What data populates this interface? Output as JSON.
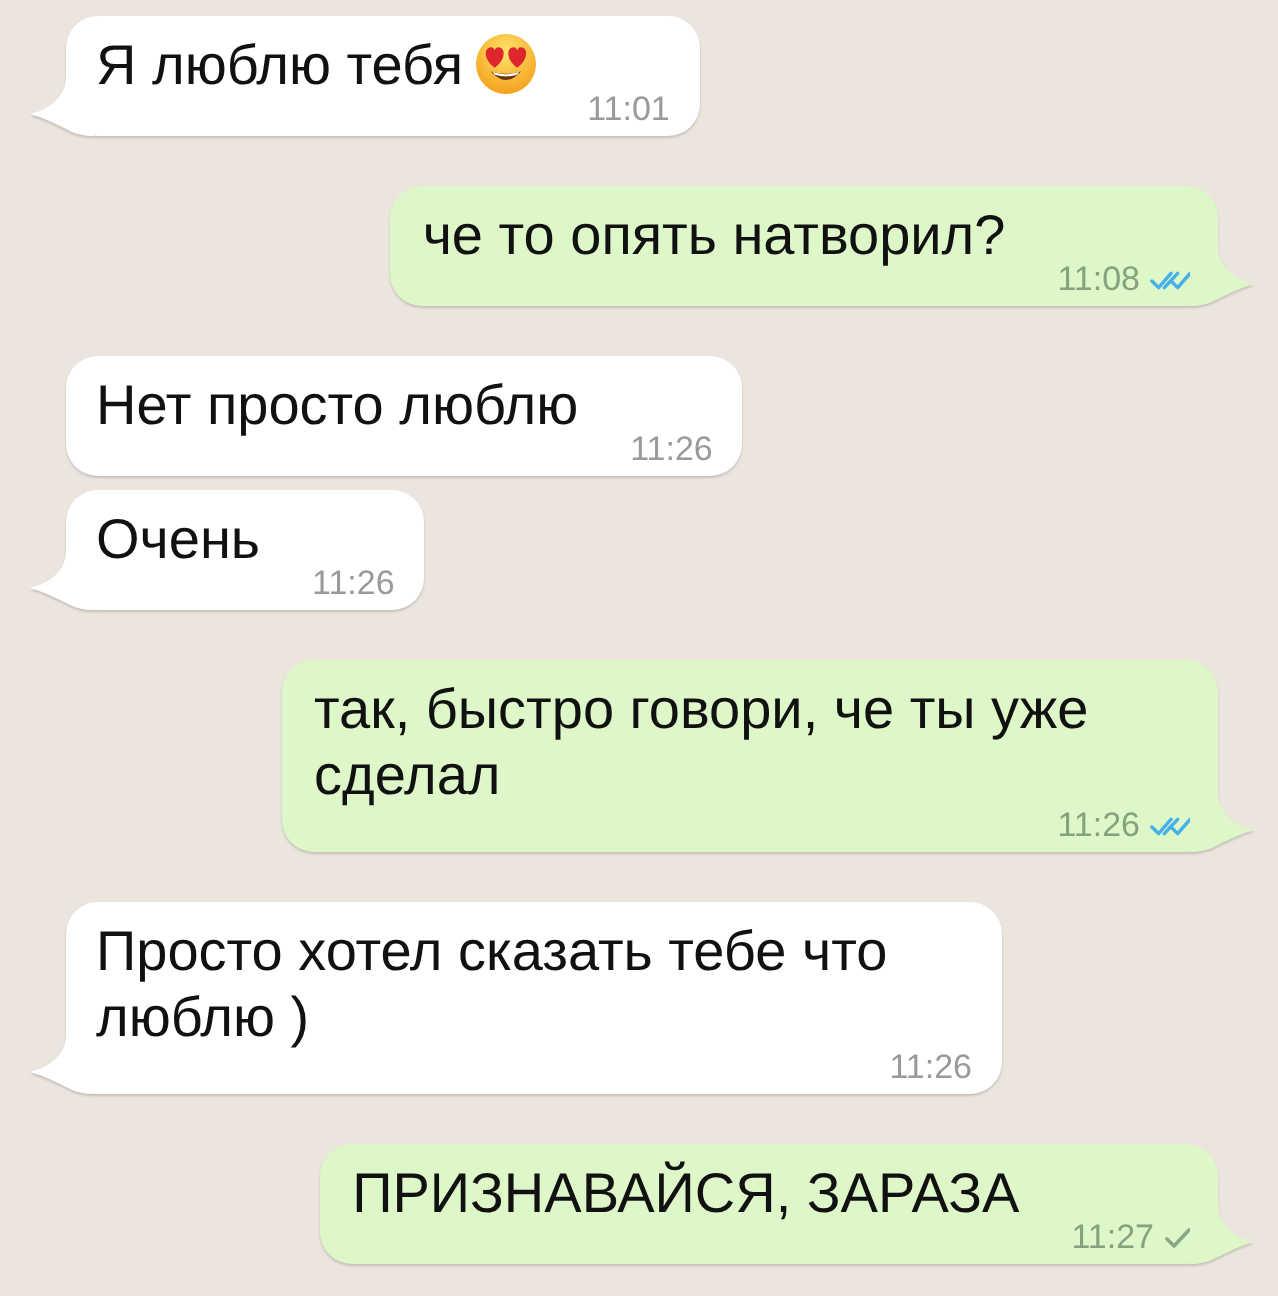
{
  "messages": [
    {
      "kind": "incoming",
      "text": "Я люблю тебя",
      "emoji": true,
      "time": "11:01",
      "tail": true
    },
    {
      "kind": "outgoing",
      "text": "че то опять натворил?",
      "emoji": false,
      "time": "11:08",
      "delivered": true,
      "read": true,
      "tail": true
    },
    {
      "kind": "incoming",
      "text": "Нет просто люблю",
      "emoji": false,
      "time": "11:26",
      "tail": false
    },
    {
      "kind": "incoming",
      "text": "Очень",
      "emoji": false,
      "time": "11:26",
      "tail": true
    },
    {
      "kind": "outgoing",
      "text": "так, быстро говори, че ты уже сделал",
      "emoji": false,
      "time": "11:26",
      "delivered": true,
      "read": true,
      "tail": true
    },
    {
      "kind": "incoming",
      "text": "Просто хотел сказать тебе что люблю )",
      "emoji": false,
      "time": "11:26",
      "tail": true
    },
    {
      "kind": "outgoing",
      "text": "ПРИЗНАВАЙСЯ, ЗАРАЗА",
      "emoji": false,
      "time": "11:27",
      "delivered": false,
      "read": false,
      "tail": true
    }
  ]
}
